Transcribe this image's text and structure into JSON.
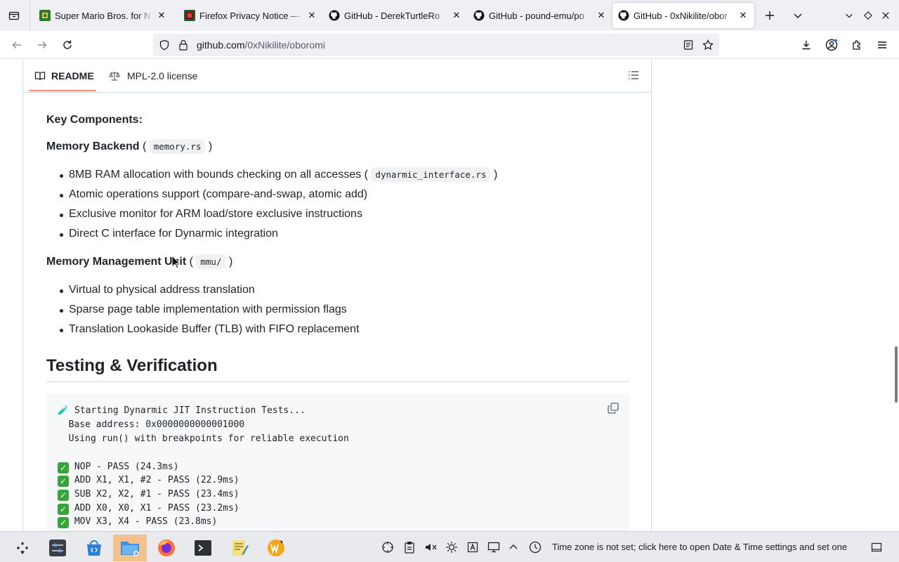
{
  "browser": {
    "tabs": [
      {
        "title": "Super Mario Bros. for N",
        "favicon": "game-icon",
        "active": false
      },
      {
        "title": "Firefox Privacy Notice —",
        "favicon": "firefox-privacy-icon",
        "active": false
      },
      {
        "title": "GitHub - DerekTurtleRo",
        "favicon": "github-icon",
        "active": false
      },
      {
        "title": "GitHub - pound-emu/po",
        "favicon": "github-icon",
        "active": false
      },
      {
        "title": "GitHub - 0xNikilite/obor",
        "favicon": "github-icon",
        "active": true
      }
    ],
    "url_host": "github.com",
    "url_path": "/0xNikilite/oboromi"
  },
  "readme_header": {
    "readme_label": "README",
    "license_label": "MPL-2.0 license"
  },
  "content": {
    "key_components": "Key Components:",
    "memory_backend": {
      "title": "Memory Backend",
      "paren_open": "(",
      "code": "memory.rs",
      "paren_close": ")",
      "items": [
        {
          "text": "8MB RAM allocation with bounds checking on all accesses (",
          "code": "dynarmic_interface.rs",
          "after": ")"
        },
        {
          "text": "Atomic operations support (compare-and-swap, atomic add)"
        },
        {
          "text": "Exclusive monitor for ARM load/store exclusive instructions"
        },
        {
          "text": "Direct C interface for Dynarmic integration"
        }
      ]
    },
    "mmu": {
      "title": "Memory Management Unit",
      "paren_open": "(",
      "code": "mmu/",
      "paren_close": ")",
      "items": [
        "Virtual to physical address translation",
        "Sparse page table implementation with permission flags",
        "Translation Lookaside Buffer (TLB) with FIFO replacement"
      ]
    },
    "testing_heading": "Testing & Verification",
    "code_lines": [
      "🧪 Starting Dynarmic JIT Instruction Tests...",
      "  Base address: 0x0000000000001000",
      "  Using run() with breakpoints for reliable execution",
      "",
      "NOP - PASS (24.3ms)",
      "ADD X1, X1, #2 - PASS (22.9ms)",
      "SUB X2, X2, #1 - PASS (23.4ms)",
      "ADD X0, X0, X1 - PASS (23.2ms)",
      "MOV X3, X4 - PASS (23.8ms)"
    ]
  },
  "taskbar": {
    "notice": "Time zone is not set; click here to open Date & Time settings and set one"
  }
}
